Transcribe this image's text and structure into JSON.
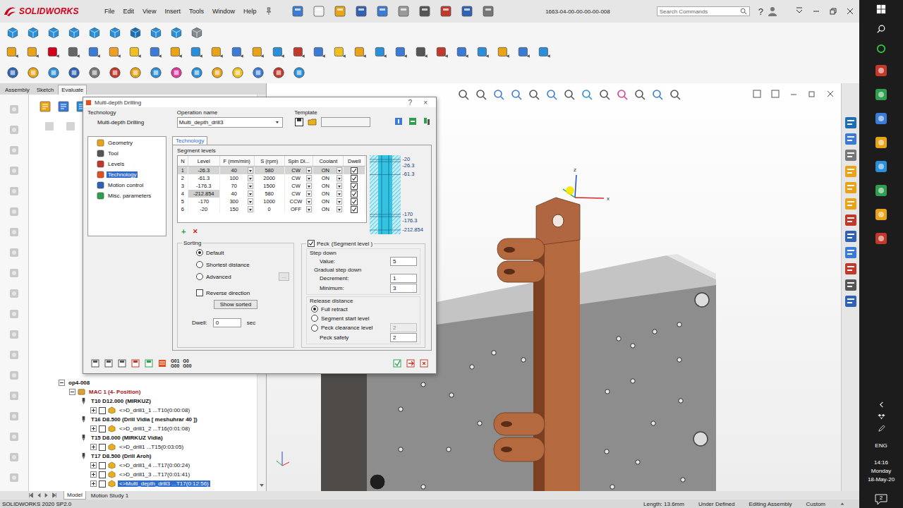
{
  "app": {
    "brand": "SOLIDWORKS",
    "menus": [
      "File",
      "Edit",
      "View",
      "Insert",
      "Tools",
      "Window",
      "Help"
    ],
    "document_title": "1663-04-00-00-00-00-008",
    "search_placeholder": "Search Commands",
    "help": "?"
  },
  "command_tabs": [
    {
      "label": "Assembly",
      "selected": false
    },
    {
      "label": "Sketch",
      "selected": false
    },
    {
      "label": "Evaluate",
      "selected": true
    }
  ],
  "dialog": {
    "title": "Multi-depth Drilling",
    "help": "?",
    "close": "×",
    "technology_label": "Technology",
    "technology": "Multi-depth Drilling",
    "operation_name_label": "Operation name",
    "operation_name": "Multi_depth_drill3",
    "template_label": "Template",
    "template": "",
    "nav": [
      {
        "label": "Geometry",
        "selected": false
      },
      {
        "label": "Tool",
        "selected": false
      },
      {
        "label": "Levels",
        "selected": false
      },
      {
        "label": "Technology",
        "selected": true
      },
      {
        "label": "Motion control",
        "selected": false
      },
      {
        "label": "Misc. parameters",
        "selected": false
      }
    ],
    "page_tab": "Technology",
    "segment_levels_label": "Segment levels",
    "columns": [
      "N",
      "Level",
      "F (mm/min)",
      "S (rpm)",
      "Spin Di...",
      "Coolant",
      "Dwell"
    ],
    "rows": [
      {
        "n": "1",
        "level": "-26.3",
        "feed": "40",
        "speed": "580",
        "spin": "CW",
        "coolant": "ON",
        "dwell": true,
        "selected": true,
        "level_highlighted": false
      },
      {
        "n": "2",
        "level": "-61.3",
        "feed": "100",
        "speed": "2000",
        "spin": "CW",
        "coolant": "ON",
        "dwell": true,
        "selected": false,
        "level_highlighted": false
      },
      {
        "n": "3",
        "level": "-176.3",
        "feed": "70",
        "speed": "1500",
        "spin": "CW",
        "coolant": "ON",
        "dwell": true,
        "selected": false,
        "level_highlighted": false
      },
      {
        "n": "4",
        "level": "-212.854",
        "feed": "40",
        "speed": "580",
        "spin": "CW",
        "coolant": "ON",
        "dwell": true,
        "selected": false,
        "level_highlighted": true
      },
      {
        "n": "5",
        "level": "-170",
        "feed": "300",
        "speed": "1000",
        "spin": "CCW",
        "coolant": "ON",
        "dwell": true,
        "selected": false,
        "level_highlighted": false
      },
      {
        "n": "6",
        "level": "-20",
        "feed": "150",
        "speed": "0",
        "spin": "OFF",
        "coolant": "ON",
        "dwell": true,
        "selected": false,
        "level_highlighted": false
      }
    ],
    "preview_labels": [
      "-20",
      "-26.3",
      "-61.3",
      "-170",
      "-176.3",
      "-212.854"
    ],
    "add": "+",
    "delete": "✕",
    "sorting": {
      "label": "Sorting",
      "options": [
        {
          "label": "Default",
          "selected": true
        },
        {
          "label": "Shortest distance",
          "selected": false
        },
        {
          "label": "Advanced",
          "selected": false
        }
      ],
      "advanced_button": "...",
      "reverse": {
        "label": "Reverse direction",
        "checked": false
      },
      "show_sorted": "Show sorted",
      "dwell_label": "Dwell:",
      "dwell": "0",
      "dwell_unit": "sec"
    },
    "peck": {
      "label": "Peck",
      "suffix": "(Segment level  )",
      "checked": true,
      "step_down_label": "Step down",
      "value_label": "Value:",
      "value": "5",
      "gradual_label": "Gradual step down",
      "decrement_label": "Decrement:",
      "decrement": "1",
      "minimum_label": "Minimum:",
      "minimum": "3",
      "release_label": "Release distance",
      "release_options": [
        {
          "label": "Full retract",
          "selected": true
        },
        {
          "label": "Segment start level",
          "selected": false
        },
        {
          "label": "Peck clearance level",
          "selected": false
        }
      ],
      "peck_clearance": "2",
      "peck_clearance_disabled": true,
      "peck_safety_label": "Peck safety",
      "peck_safety": "2"
    },
    "footer_codes": [
      {
        "top": "G01",
        "bottom": "G00"
      },
      {
        "top": "G0",
        "bottom": "G00"
      }
    ]
  },
  "feature_tree": [
    {
      "label": "op4-008",
      "kind": "setup",
      "depth": 0,
      "expanded": true,
      "selected": false
    },
    {
      "label": "MAC 1 (4- Position)",
      "kind": "machine",
      "depth": 1,
      "expanded": true,
      "selected": false
    },
    {
      "label": "T10 D12.000 (MIRKUZ)",
      "kind": "tool",
      "depth": 2,
      "selected": false
    },
    {
      "label": "<>D_drill1_1 ...T10(0:00:08)",
      "kind": "operation",
      "depth": 3,
      "expanded": false,
      "checked": false,
      "selected": false
    },
    {
      "label": "T16 D8.500 (Drill Vidia [ meshuhrar 40 ])",
      "kind": "tool",
      "depth": 2,
      "selected": false
    },
    {
      "label": "<>D_drill1_2 ...T16(0:01:08)",
      "kind": "operation",
      "depth": 3,
      "expanded": false,
      "checked": false,
      "selected": false
    },
    {
      "label": "T15 D8.000 (MIRKUZ Vidia)",
      "kind": "tool",
      "depth": 2,
      "selected": false
    },
    {
      "label": "<>D_drill1 ...T15(0:03:05)",
      "kind": "operation",
      "depth": 3,
      "expanded": false,
      "checked": false,
      "selected": false
    },
    {
      "label": "T17 D8.500 (Drill Aroh)",
      "kind": "tool",
      "depth": 2,
      "selected": false
    },
    {
      "label": "<>D_drill1_4 ...T17(0:00:24)",
      "kind": "operation",
      "depth": 3,
      "expanded": false,
      "checked": false,
      "selected": false
    },
    {
      "label": "<>D_drill1_3 ...T17(0:01:41)",
      "kind": "operation",
      "depth": 3,
      "expanded": false,
      "checked": false,
      "selected": false
    },
    {
      "label": "<>Multi_depth_drill3 ...T17(0:12:56)",
      "kind": "operation",
      "depth": 3,
      "expanded": false,
      "checked": false,
      "selected": true
    }
  ],
  "triad_labels": [
    "z",
    "x"
  ],
  "model_tabs": [
    {
      "label": "Model",
      "selected": true
    },
    {
      "label": "Motion Study 1",
      "selected": false
    }
  ],
  "status_bar": {
    "product": "SOLIDWORKS 2020 SP2.0",
    "fields": [
      "Length: 13.6mm",
      "Under Defined",
      "Editing Assembly",
      "Custom"
    ]
  },
  "taskbar": {
    "language": "ENG",
    "time": "14:16",
    "day": "Monday",
    "date": "18-May-20",
    "notifications": "2"
  }
}
